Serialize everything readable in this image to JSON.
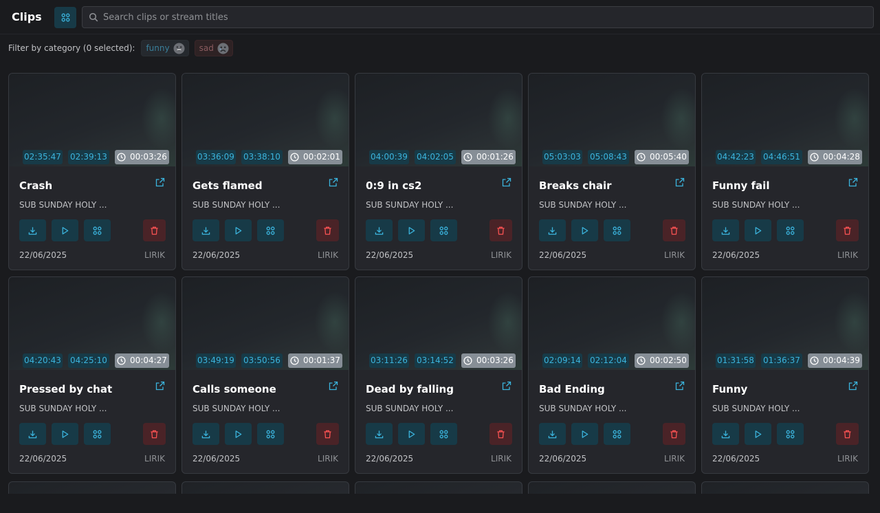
{
  "app": {
    "title": "Clips"
  },
  "search": {
    "placeholder": "Search clips or stream titles",
    "value": ""
  },
  "filter": {
    "label": "Filter by category (0 selected):",
    "categories": [
      {
        "label": "funny",
        "emoji": "grinning-face"
      },
      {
        "label": "sad",
        "emoji": "sad-face"
      }
    ]
  },
  "colors": {
    "background": "#1a1b1e",
    "card": "#25262b",
    "accent": "#3bb4dd",
    "accent_bg": "#173a47",
    "danger": "#fa5252",
    "danger_bg": "#4a2327",
    "duration_bg": "#868e96"
  },
  "icons": {
    "view_toggle": "grid-icon",
    "search": "search-icon",
    "external": "external-link-icon",
    "download": "download-icon",
    "play": "play-icon",
    "categorize": "grid-icon",
    "delete": "trash-icon",
    "duration": "clock-icon"
  },
  "clips": [
    {
      "start": "02:35:47",
      "end": "02:39:13",
      "duration": "00:03:26",
      "title": "Crash",
      "stream": "SUB SUNDAY HOLY ...",
      "date": "22/06/2025",
      "channel": "LIRIK"
    },
    {
      "start": "03:36:09",
      "end": "03:38:10",
      "duration": "00:02:01",
      "title": "Gets flamed",
      "stream": "SUB SUNDAY HOLY ...",
      "date": "22/06/2025",
      "channel": "LIRIK"
    },
    {
      "start": "04:00:39",
      "end": "04:02:05",
      "duration": "00:01:26",
      "title": "0:9 in cs2",
      "stream": "SUB SUNDAY HOLY ...",
      "date": "22/06/2025",
      "channel": "LIRIK"
    },
    {
      "start": "05:03:03",
      "end": "05:08:43",
      "duration": "00:05:40",
      "title": "Breaks chair",
      "stream": "SUB SUNDAY HOLY ...",
      "date": "22/06/2025",
      "channel": "LIRIK"
    },
    {
      "start": "04:42:23",
      "end": "04:46:51",
      "duration": "00:04:28",
      "title": "Funny fail",
      "stream": "SUB SUNDAY HOLY ...",
      "date": "22/06/2025",
      "channel": "LIRIK"
    },
    {
      "start": "04:20:43",
      "end": "04:25:10",
      "duration": "00:04:27",
      "title": "Pressed by chat",
      "stream": "SUB SUNDAY HOLY ...",
      "date": "22/06/2025",
      "channel": "LIRIK"
    },
    {
      "start": "03:49:19",
      "end": "03:50:56",
      "duration": "00:01:37",
      "title": "Calls someone",
      "stream": "SUB SUNDAY HOLY ...",
      "date": "22/06/2025",
      "channel": "LIRIK"
    },
    {
      "start": "03:11:26",
      "end": "03:14:52",
      "duration": "00:03:26",
      "title": "Dead by falling",
      "stream": "SUB SUNDAY HOLY ...",
      "date": "22/06/2025",
      "channel": "LIRIK"
    },
    {
      "start": "02:09:14",
      "end": "02:12:04",
      "duration": "00:02:50",
      "title": "Bad Ending",
      "stream": "SUB SUNDAY HOLY ...",
      "date": "22/06/2025",
      "channel": "LIRIK"
    },
    {
      "start": "01:31:58",
      "end": "01:36:37",
      "duration": "00:04:39",
      "title": "Funny",
      "stream": "SUB SUNDAY HOLY ...",
      "date": "22/06/2025",
      "channel": "LIRIK"
    }
  ]
}
